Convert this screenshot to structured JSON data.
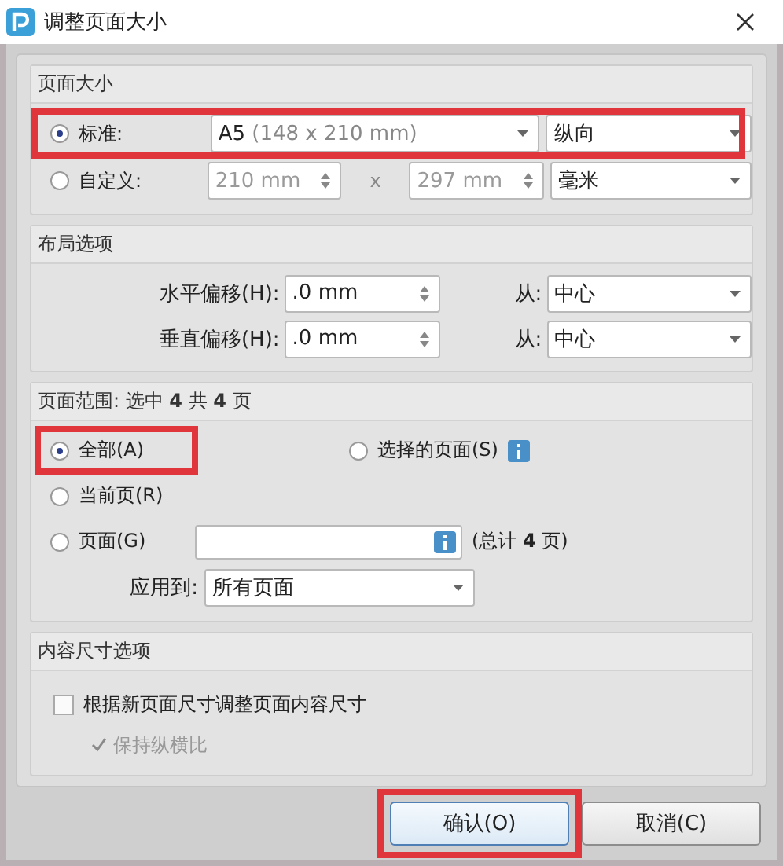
{
  "window": {
    "title": "调整页面大小"
  },
  "page_size": {
    "title": "页面大小",
    "options": [
      {
        "kind": "standard",
        "label": "标准:",
        "selected": true,
        "highlighted": true,
        "size": "A5",
        "size_detail": "(148 x 210 mm)",
        "orientation": "纵向"
      },
      {
        "kind": "custom",
        "label": "自定义:",
        "selected": false,
        "highlighted": false,
        "width": "210 mm",
        "separator": "x",
        "height": "297 mm",
        "unit": "毫米"
      }
    ]
  },
  "layout": {
    "title": "布局选项",
    "rows": [
      {
        "label": "水平偏移(H):",
        "value": ".0 mm",
        "from_label": "从:",
        "from": "中心"
      },
      {
        "label": "垂直偏移(H):",
        "value": ".0 mm",
        "from_label": "从:",
        "from": "中心"
      }
    ]
  },
  "page_range": {
    "title": "页面范围: 选中 **4** 共 **4** 页",
    "options": [
      {
        "kind": "all",
        "label": "全部(A)",
        "selected": true,
        "highlighted": true
      },
      {
        "kind": "selection",
        "label": "选择的页面(S)",
        "selected": false,
        "highlighted": false
      },
      {
        "kind": "current",
        "label": "当前页(R)",
        "selected": false,
        "highlighted": false
      },
      {
        "kind": "pages",
        "label": "页面(G)",
        "selected": false,
        "highlighted": false,
        "total": "(总计 **4** 页)"
      }
    ],
    "apply": {
      "label": "应用到:",
      "value": "所有页面"
    }
  },
  "content": {
    "title": "内容尺寸选项",
    "checkboxes": [
      {
        "label": "根据新页面尺寸调整页面内容尺寸",
        "checked": false,
        "disabled": false
      },
      {
        "label": "保持纵横比",
        "checked": true,
        "disabled": true
      }
    ]
  },
  "buttons": [
    {
      "label": "确认(O)",
      "highlighted": true
    },
    {
      "label": "取消(C)",
      "highlighted": false
    }
  ]
}
